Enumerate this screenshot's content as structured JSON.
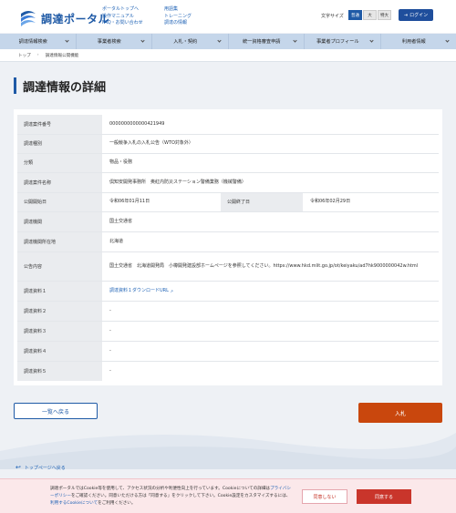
{
  "header": {
    "logo_text": "調達ポータル",
    "links_col1": [
      "ポータルトップへ",
      "操作マニュアル",
      "FAQ・お問い合わせ"
    ],
    "links_col2": [
      "用語集",
      "トレーニング",
      "調達の情報"
    ],
    "font_size_label": "文字サイズ",
    "font_sizes": [
      "普通",
      "大",
      "特大"
    ],
    "login_label": "ログイン"
  },
  "nav": {
    "items": [
      "調達情報検索",
      "事業者検索",
      "入札・契約",
      "統一資格審査申請",
      "事業者プロフィール",
      "利用者情報"
    ]
  },
  "breadcrumb": {
    "home": "トップ",
    "current": "調達情報公開機能"
  },
  "page_title": "調達情報の詳細",
  "details": {
    "case_no_label": "調達案件番号",
    "case_no": "0000000000000421949",
    "type_label": "調達種別",
    "type": "一般競争入札の入札公告（WTO対象外）",
    "category_label": "分類",
    "category": "物品・役務",
    "name_label": "調達案件名称",
    "name": "倶知安開発事務所　奥紅内防災ステーション警備業務（機械警備）",
    "start_label": "公開開始日",
    "start": "令和06年01月11日",
    "end_label": "公開終了日",
    "end": "令和06年02月29日",
    "org_label": "調達機関",
    "org": "国土交通省",
    "location_label": "調達機関所在地",
    "location": "北海道",
    "notice_label": "公告内容",
    "notice": "国土交通省　北海道開発局　小樽開発建設部ホームページを参照してください。https://www.hkd.mlit.go.jp/ot/keiyaku/ad7hk9000000042w.html",
    "doc1_label": "調達資料１",
    "doc1": "調達資料１ダウンロードURL",
    "doc2_label": "調達資料２",
    "doc2": "-",
    "doc3_label": "調達資料３",
    "doc3": "-",
    "doc4_label": "調達資料４",
    "doc4": "-",
    "doc5_label": "調達資料５",
    "doc5": "-"
  },
  "buttons": {
    "back": "一覧へ戻る",
    "bid": "入札"
  },
  "to_top": "トップページへ戻る",
  "cookie": {
    "text_1": "調達ポータルではCookie等を使用して、アクセス状況の分析や利便性向上を行っています。Cookieについての詳細は",
    "privacy_link": "プライバシーポリシー",
    "text_2": "をご確認ください。同意いただける方は「同意する」をクリックして下さい。Cookie設定をカスタマイズするには、",
    "usage_link": "利用するCookieについて",
    "text_3": "をご利用ください。",
    "deny": "同意しない",
    "agree": "同意する"
  }
}
